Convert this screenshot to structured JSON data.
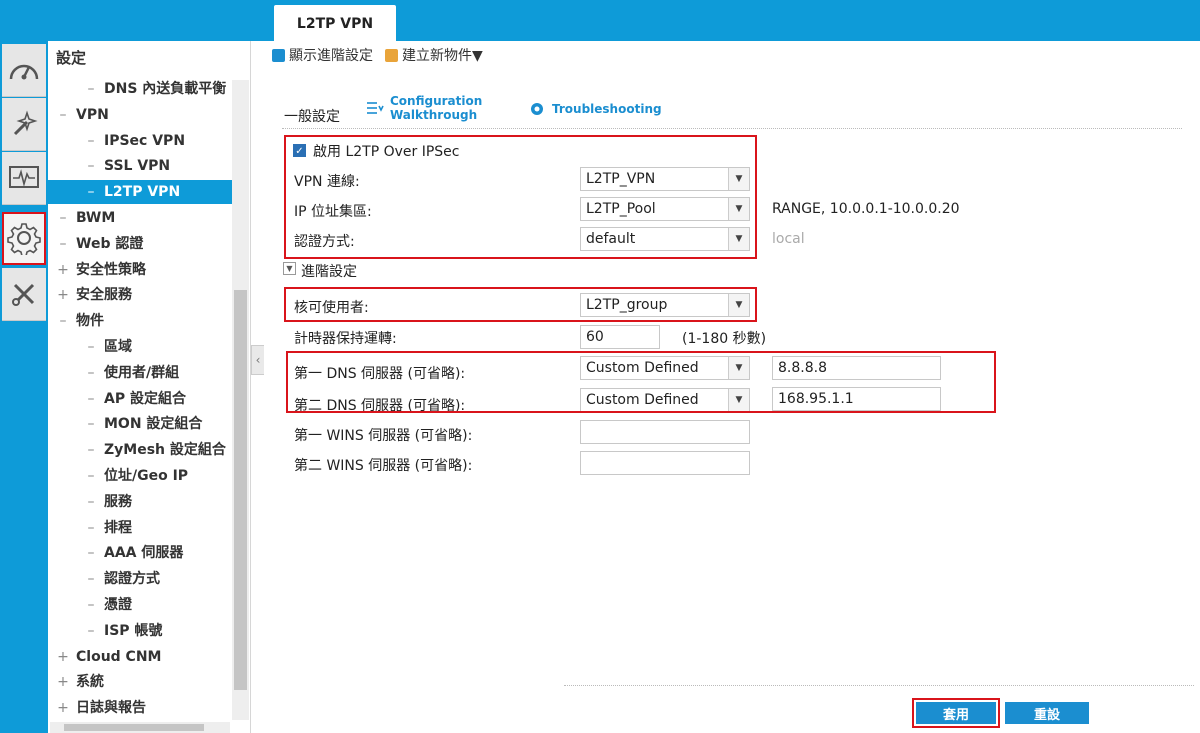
{
  "header": {
    "active_tab": "L2TP VPN"
  },
  "rail": {
    "items": [
      {
        "icon": "dashboard-gauge-icon"
      },
      {
        "icon": "magic-wand-icon"
      },
      {
        "icon": "monitor-pulse-icon"
      },
      {
        "icon": "gear-icon",
        "active": true
      },
      {
        "icon": "maintenance-tools-icon"
      }
    ]
  },
  "nav": {
    "title": "設定",
    "items": [
      {
        "prefix": "–",
        "label": "DNS 內送負載平衡",
        "level": 2
      },
      {
        "prefix": "–",
        "label": "VPN",
        "level": 1
      },
      {
        "prefix": "–",
        "label": "IPSec VPN",
        "level": 2
      },
      {
        "prefix": "–",
        "label": "SSL VPN",
        "level": 2
      },
      {
        "prefix": "–",
        "label": "L2TP VPN",
        "level": 2,
        "selected": true
      },
      {
        "prefix": "–",
        "label": "BWM",
        "level": 1
      },
      {
        "prefix": "–",
        "label": "Web 認證",
        "level": 1
      },
      {
        "prefix": "+",
        "label": "安全性策略",
        "level": 1
      },
      {
        "prefix": "+",
        "label": "安全服務",
        "level": 1
      },
      {
        "prefix": "–",
        "label": "物件",
        "level": 1
      },
      {
        "prefix": "–",
        "label": "區域",
        "level": 2
      },
      {
        "prefix": "–",
        "label": "使用者/群組",
        "level": 2
      },
      {
        "prefix": "–",
        "label": "AP 設定組合",
        "level": 2
      },
      {
        "prefix": "–",
        "label": "MON 設定組合",
        "level": 2
      },
      {
        "prefix": "–",
        "label": "ZyMesh 設定組合",
        "level": 2
      },
      {
        "prefix": "–",
        "label": "位址/Geo IP",
        "level": 2
      },
      {
        "prefix": "–",
        "label": "服務",
        "level": 2
      },
      {
        "prefix": "–",
        "label": "排程",
        "level": 2
      },
      {
        "prefix": "–",
        "label": "AAA 伺服器",
        "level": 2
      },
      {
        "prefix": "–",
        "label": "認證方式",
        "level": 2
      },
      {
        "prefix": "–",
        "label": "憑證",
        "level": 2
      },
      {
        "prefix": "–",
        "label": "ISP 帳號",
        "level": 2
      },
      {
        "prefix": "+",
        "label": "Cloud CNM",
        "level": 1
      },
      {
        "prefix": "+",
        "label": "系統",
        "level": 1
      },
      {
        "prefix": "+",
        "label": "日誌與報告",
        "level": 1
      }
    ]
  },
  "toolbar": {
    "show_advanced": "顯示進階設定",
    "create_object": "建立新物件▼"
  },
  "general": {
    "title": "一般設定",
    "walkthrough_line1": "Configuration",
    "walkthrough_line2": "Walkthrough",
    "troubleshooting": "Troubleshooting"
  },
  "form": {
    "enable_label": "啟用 L2TP Over IPSec",
    "vpn_conn_label": "VPN 連線:",
    "vpn_conn_value": "L2TP_VPN",
    "ip_pool_label": "IP 位址集區:",
    "ip_pool_value": "L2TP_Pool",
    "ip_pool_info": "RANGE, 10.0.0.1-10.0.0.20",
    "auth_label": "認證方式:",
    "auth_value": "default",
    "auth_info": "local",
    "advanced_label": "進階設定",
    "allowed_user_label": "核可使用者:",
    "allowed_user_value": "L2TP_group",
    "keepalive_label": "計時器保持運轉:",
    "keepalive_value": "60",
    "keepalive_hint": "(1-180 秒數)",
    "dns1_label": "第一 DNS 伺服器 (可省略):",
    "dns1_type": "Custom Defined",
    "dns1_value": "8.8.8.8",
    "dns2_label": "第二 DNS 伺服器 (可省略):",
    "dns2_type": "Custom Defined",
    "dns2_value": "168.95.1.1",
    "wins1_label": "第一 WINS 伺服器 (可省略):",
    "wins1_value": "",
    "wins2_label": "第二 WINS 伺服器 (可省略):",
    "wins2_value": ""
  },
  "buttons": {
    "apply": "套用",
    "reset": "重設"
  },
  "colors": {
    "accent": "#0e9bd8",
    "highlight": "#d9141b"
  }
}
